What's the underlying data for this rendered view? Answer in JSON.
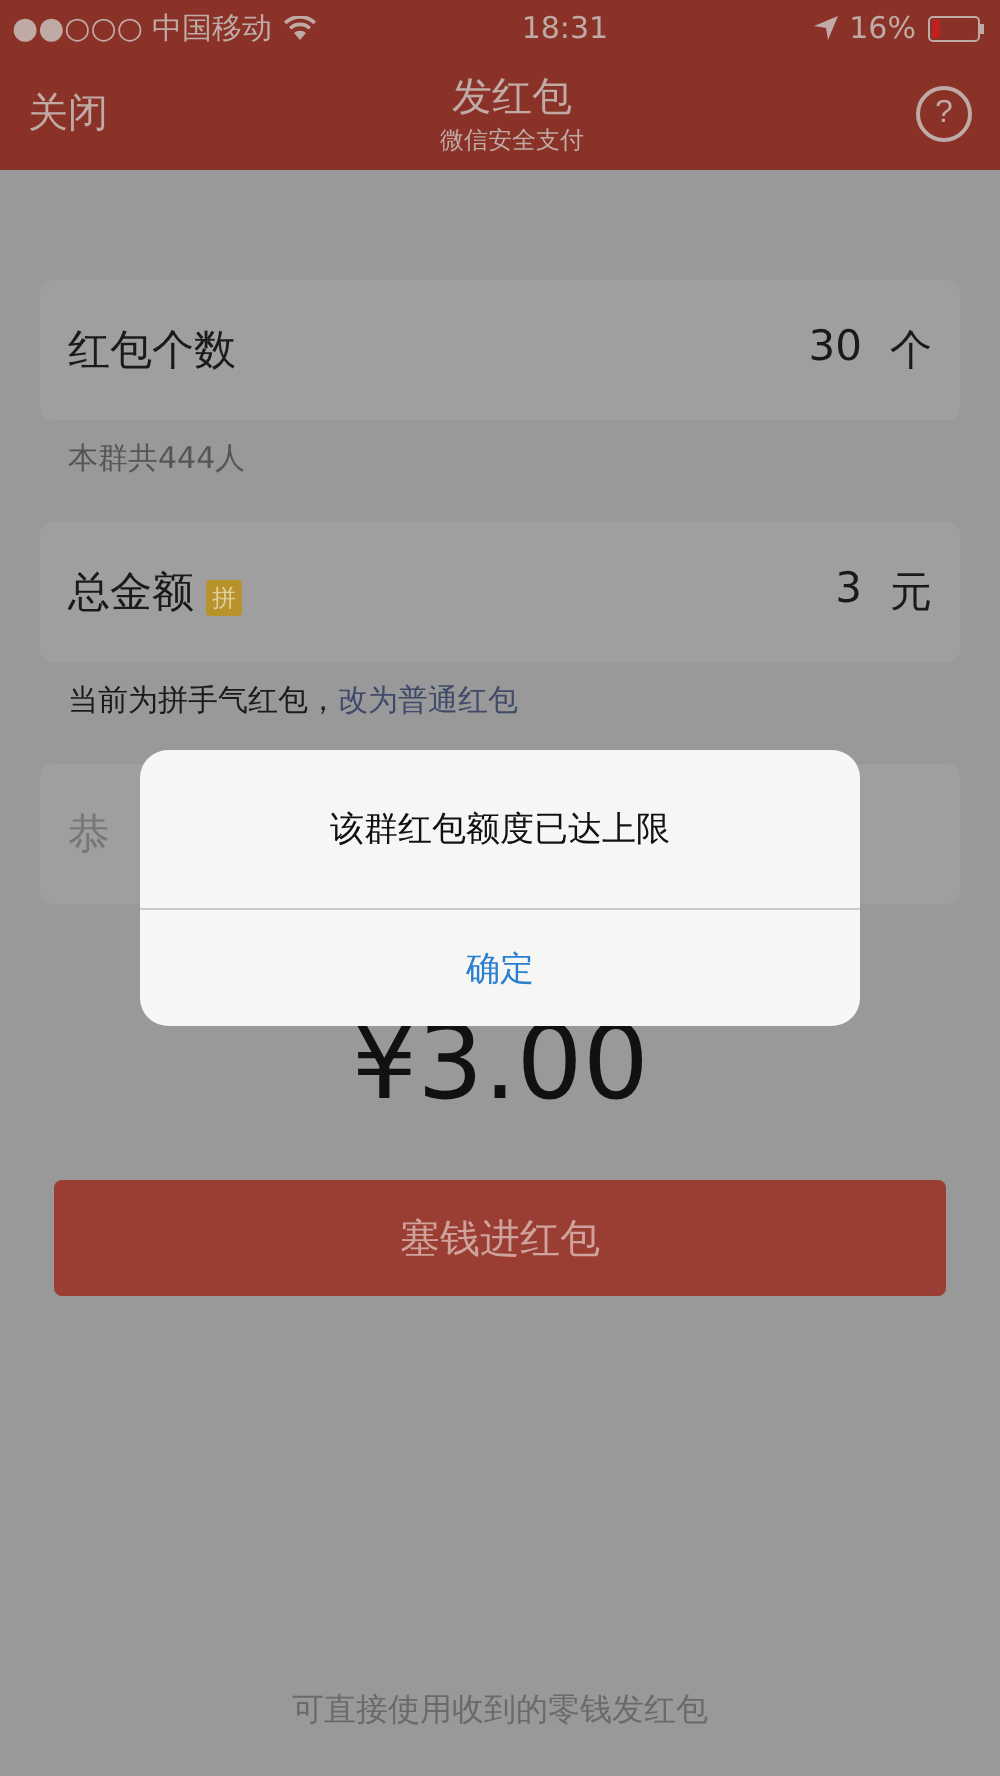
{
  "status_bar": {
    "carrier": "●●○○○ 中国移动",
    "time": "18:31",
    "battery": "16%"
  },
  "nav": {
    "close": "关闭",
    "title": "发红包",
    "subtitle": "微信安全支付",
    "help": "?"
  },
  "count_field": {
    "label": "红包个数",
    "value": "30",
    "unit": "个"
  },
  "count_note": "本群共444人",
  "amount_field": {
    "label": "总金额",
    "badge": "拼",
    "value": "3",
    "unit": "元"
  },
  "mode_note": {
    "text": "当前为拼手气红包，",
    "link": "改为普通红包"
  },
  "greeting_field": {
    "placeholder": "恭"
  },
  "total": "¥3.00",
  "submit": "塞钱进红包",
  "footer": "可直接使用收到的零钱发红包",
  "alert": {
    "message": "该群红包额度已达上限",
    "button": "确定"
  }
}
